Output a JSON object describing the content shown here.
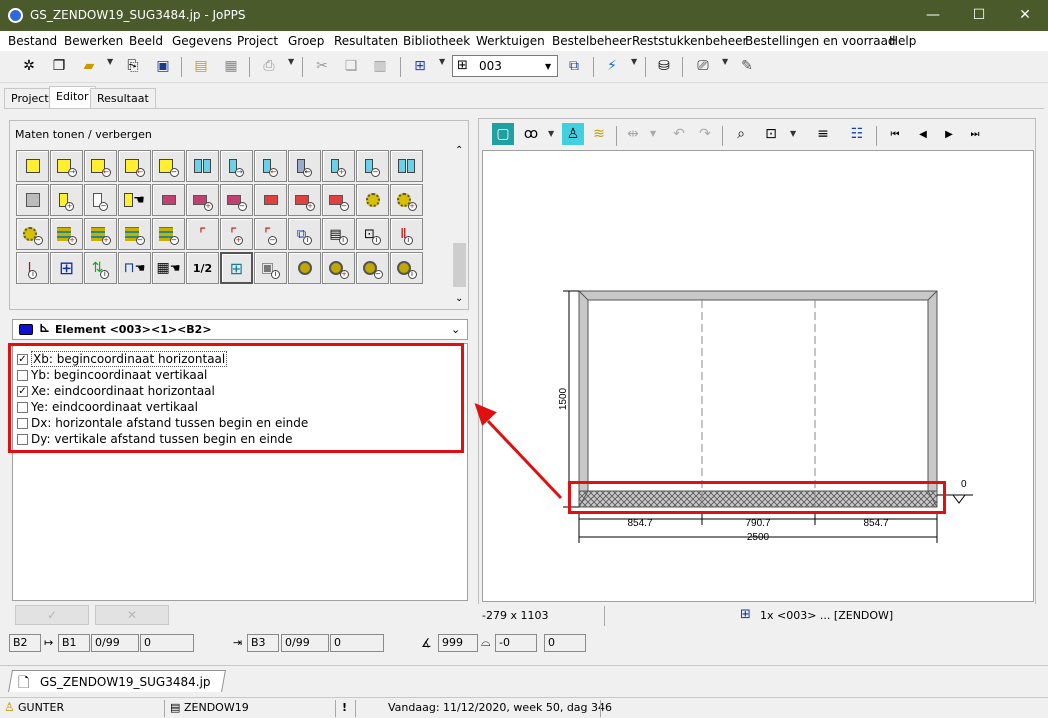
{
  "window": {
    "title": "GS_ZENDOW19_SUG3484.jp - JoPPS",
    "minimize": "—",
    "maximize": "☐",
    "close": "✕"
  },
  "menu": [
    "Bestand",
    "Bewerken",
    "Beeld",
    "Gegevens",
    "Project",
    "Groep",
    "Resultaten",
    "Bibliotheek",
    "Werktuigen",
    "Bestelbeheer",
    "Reststukkenbeheer",
    "Bestellingen en voorraad",
    "Help"
  ],
  "toolbar": {
    "combo_value": "003"
  },
  "tabs": [
    "Project",
    "Editor",
    "Resultaat"
  ],
  "left_panel": {
    "title": "Maten tonen / verbergen",
    "fraction_label": "1/2"
  },
  "element_combo": "Element <003><1><B2>",
  "checklist": [
    {
      "label": "Xb: begincoordinaat horizontaal",
      "checked": true
    },
    {
      "label": "Yb: begincoordinaat vertikaal",
      "checked": false
    },
    {
      "label": "Xe: eindcoordinaat horizontaal",
      "checked": true
    },
    {
      "label": "Ye: eindcoordinaat vertikaal",
      "checked": false
    },
    {
      "label": "Dx: horizontale afstand tussen begin en einde",
      "checked": false
    },
    {
      "label": "Dy: vertikale afstand tussen begin en einde",
      "checked": false
    }
  ],
  "buttons": {
    "ok": "✓",
    "cancel": "✕"
  },
  "drawing": {
    "height_label": "1500",
    "zero_label": "0",
    "dims_segments": [
      "854.7",
      "790.7",
      "854.7"
    ],
    "dims_total": "2500"
  },
  "right_status": {
    "coords": "-279 x 1103",
    "selection": "1x <003> ... [ZENDOW]"
  },
  "bottom_fields": {
    "f1": "B2",
    "f2": "B1",
    "f3": "0/99",
    "f4": "0",
    "f5": "B3",
    "f6": "0/99",
    "f7": "0",
    "f8": "999",
    "f9": "-0",
    "f10": "0"
  },
  "doc_tab": "GS_ZENDOW19_SUG3484.jp",
  "statusbar": {
    "user": "GUNTER",
    "project": "ZENDOW19",
    "warn": "!",
    "date": "Vandaag: 11/12/2020, week 50, dag 346"
  }
}
